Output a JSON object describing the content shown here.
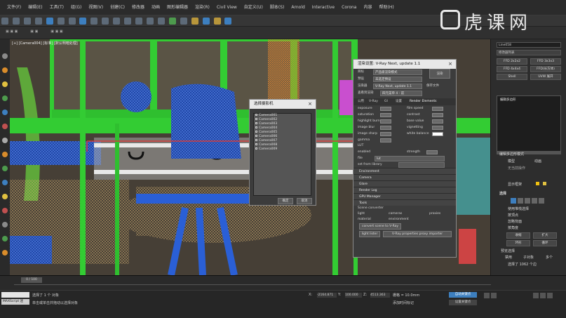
{
  "menubar": {
    "items": [
      "文件(F)",
      "编辑(E)",
      "工具(T)",
      "组(G)",
      "视图(V)",
      "创建(C)",
      "修改器",
      "动画",
      "图形编辑器",
      "渲染(R)",
      "Civil View",
      "自定义(U)",
      "脚本(S)",
      "Arnold",
      "Interactive",
      "Corona",
      "内容",
      "帮助(H)"
    ]
  },
  "viewport": {
    "label": "[+] [Camera004] [标准] [默认明暗处理]"
  },
  "camera_dialog": {
    "title": "选择摄影机",
    "items": [
      "Camera001",
      "Camera002",
      "Camera003",
      "Camera004",
      "Camera005",
      "Camera006",
      "Camera007",
      "Camera008",
      "Camera009"
    ],
    "ok": "确定",
    "cancel": "取消"
  },
  "vray_dialog": {
    "title": "渲染设置: V-Ray Next, update 1.1",
    "target_label": "目标",
    "target_value": "产品级渲染模式",
    "preset_label": "预设",
    "preset_value": "未选定预设",
    "renderer_label": "渲染器",
    "renderer_value": "V-Ray Next, update 1.1",
    "save_file": "保存文件",
    "view_label": "查看到渲染",
    "view_value": "四元菜单 4 - 前",
    "render_btn": "渲染",
    "tabs": [
      "公用",
      "V-Ray",
      "GI",
      "设置",
      "Render Elements"
    ],
    "params": [
      {
        "label": "exposure",
        "value": "16.0",
        "label2": "film speed",
        "value2": "100.0"
      },
      {
        "label": "saturation",
        "value": "1.0",
        "label2": "contrast",
        "value2": "0.0"
      },
      {
        "label": "highlight burn",
        "value": "1.0",
        "label2": "base value",
        "value2": "0.0"
      },
      {
        "label": "image blur",
        "value": "1.0",
        "label2": "vignetting",
        "value2": "0.0"
      },
      {
        "label": "image sharp",
        "value": "0.1",
        "label2": "white balance",
        "value2": ""
      },
      {
        "label": "gamma",
        "value": "1.0",
        "label2": "",
        "value2": ""
      }
    ],
    "lut_label": "LUT",
    "lut_enabled": "enabled",
    "lut_strength": "strength",
    "lut_strength_value": "1.0",
    "lut_file": "file",
    "lut_file_value": "lut",
    "lut_library": "set from library",
    "sections": [
      "Environment",
      "Camera",
      "Glare",
      "Render Log",
      "GPU Manager",
      "Tools"
    ],
    "scene_converter": "Scene converter",
    "light": "light",
    "cameras": "cameras",
    "proxies": "proxies",
    "material": "material",
    "environment": "environment",
    "convert_btn": "convert scene to V-Ray",
    "light_lister": "light lister",
    "vfb_props": "V-Ray properties proxy importer"
  },
  "cmdpanel": {
    "object_name": "Line058",
    "modifier_list": "修改器列表",
    "buttons": [
      "FFD 2x2x2",
      "FFD 3x3x3",
      "FFD 4x4x4",
      "FFD(长方体)",
      "Shell",
      "UVW 展开"
    ],
    "stack_item": "编辑多边形",
    "rollout_select": "编辑多边形模式",
    "mode_model": "模型",
    "mode_anim": "动画",
    "no_op": "无当前操作",
    "show_cage": "显示框架",
    "selection": "选择",
    "use_stack": "使用堆栈选择",
    "by_vertex": "按顶点",
    "ignore_back": "忽略背面",
    "by_angle": "按角度",
    "shrink": "收缩",
    "grow": "扩大",
    "ring": "环形",
    "loop": "循环",
    "preview": "预览选择",
    "off": "禁用",
    "subobj": "子对象",
    "multi": "多个",
    "selected_count": "选择了 1062 个边"
  },
  "timeline": {
    "frame": "0 / 100"
  },
  "status": {
    "selected": "选择了 1 个 对象",
    "hint": "单击或单击并拖动以选择对象",
    "maxscript": "MAXScript 迷",
    "x_label": "X:",
    "x_value": "-2164.871",
    "y_label": "Y:",
    "y_value": "100.000",
    "z_label": "Z:",
    "z_value": "4513.363",
    "grid": "栅格 = 10.0mm",
    "add_tag": "添加时间标记",
    "auto_key": "自动关键点",
    "set_key": "设置关键点"
  },
  "watermark": {
    "text": "虎课网"
  },
  "colors": {
    "accent": "#3d7fbf",
    "green_frame": "#33cc33",
    "blue_chair": "#2a5fd6",
    "orange": "#e0852e"
  }
}
